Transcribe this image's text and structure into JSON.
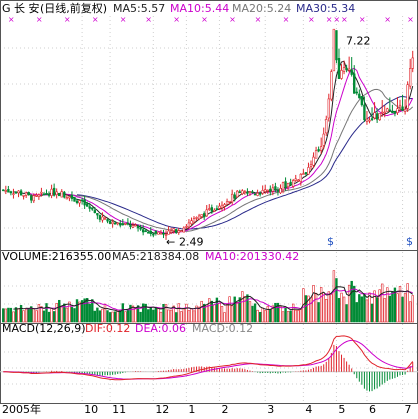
{
  "colors": {
    "up": "#e0232a",
    "down": "#008a35",
    "ma5": "#222222",
    "ma10": "#cc00cc",
    "ma20": "#777777",
    "ma30": "#2a2a8a",
    "grid": "#cfcfcf",
    "frame": "#555555",
    "marker": "#d000d0",
    "info": "#2050c0"
  },
  "chart_data": {
    "type": "stock_candlestick",
    "header": {
      "code_glyph": "G",
      "name": "长 安",
      "period": "(日线,前复权)",
      "ma5": "MA5:5.57",
      "ma10": "MA10:5.44",
      "ma20": "MA20:5.24",
      "ma30": "MA30:5.34"
    },
    "price_range": [
      2.2,
      7.6
    ],
    "volume_range": [
      0,
      520000
    ],
    "macd_range": [
      -0.55,
      0.75
    ],
    "annotations": {
      "high": "7.22",
      "low": "2.49",
      "low_arrow": "←",
      "info_mark": "$"
    },
    "volume_panel": {
      "volume": "VOLUME:216355.00",
      "ma5": "MA5:218384.08",
      "ma10": "MA10:201330.42"
    },
    "macd_panel": {
      "name": "MACD(12,26,9)",
      "dif": "DIF:0.12",
      "dea": "DEA:0.06",
      "macd": "MACD:0.12"
    },
    "x_axis": {
      "labels": [
        "2005年",
        "10",
        "11",
        "12",
        "1",
        "2",
        "3",
        "4",
        "5",
        "6",
        "7"
      ],
      "label_index": [
        0,
        31,
        42,
        59,
        72,
        85,
        103,
        118,
        131,
        143,
        157
      ]
    },
    "bar_count": 162,
    "peaks_index": [
      130,
      136,
      143,
      161
    ]
  }
}
